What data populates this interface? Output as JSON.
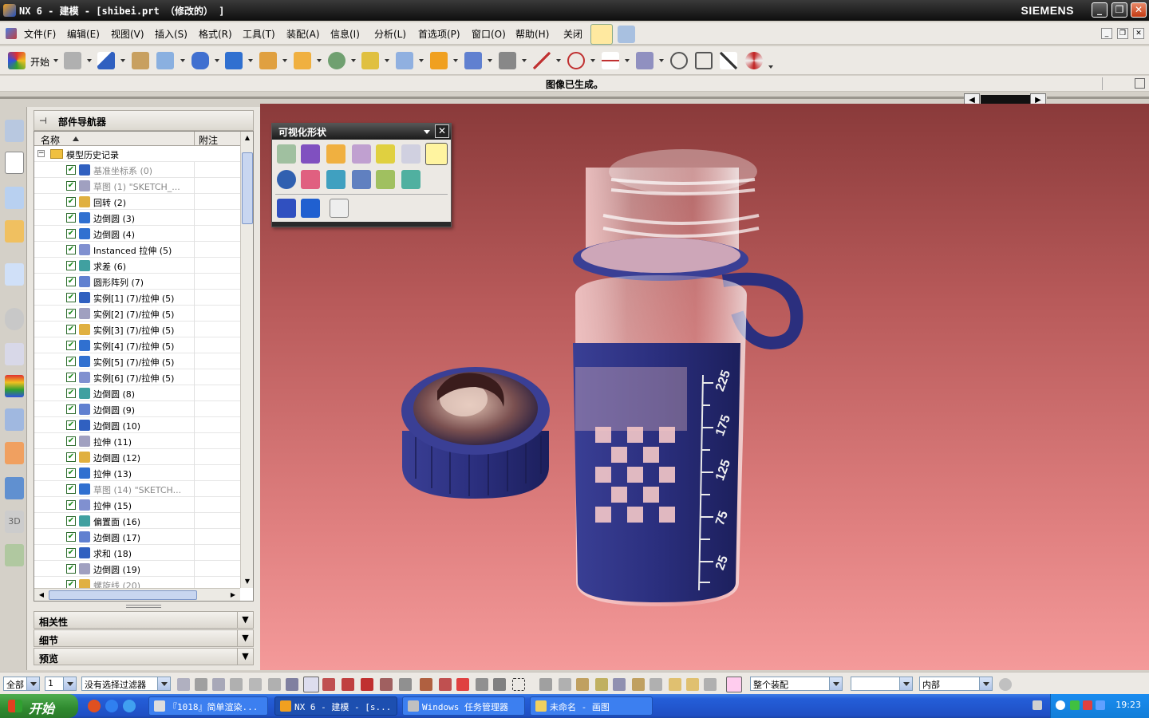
{
  "window": {
    "title": "NX 6 - 建模 - [shibei.prt （修改的） ]",
    "brand": "SIEMENS"
  },
  "menubar": {
    "items": [
      "文件(F)",
      "编辑(E)",
      "视图(V)",
      "插入(S)",
      "格式(R)",
      "工具(T)",
      "装配(A)",
      "信息(I)",
      "分析(L)",
      "首选项(P)",
      "窗口(O)",
      "帮助(H)"
    ],
    "close_label": "关闭"
  },
  "toolbar": {
    "start_label": "开始",
    "icons": [
      "start-icon",
      "sketch-icon",
      "datum-csys-icon",
      "extrude-icon",
      "revolve-icon",
      "cylinder-icon",
      "block-icon",
      "unite-icon",
      "shell-icon",
      "hole-icon",
      "offset-face-icon",
      "surface-icon",
      "blend-icon",
      "mirror-icon",
      "thicken-icon",
      "line-icon",
      "arc-icon",
      "trim-icon",
      "curve-icon",
      "point-icon",
      "scale-icon",
      "move-icon",
      "color-wheel-icon"
    ]
  },
  "statusline": {
    "message": "图像已生成。"
  },
  "navigator": {
    "title": "部件导航器",
    "columns": {
      "name": "名称",
      "note": "附注"
    },
    "root": "模型历史记录",
    "items": [
      {
        "label": "基准坐标系 (0)",
        "grey": true
      },
      {
        "label": "草图 (1) \"SKETCH_...",
        "grey": true
      },
      {
        "label": "回转 (2)",
        "grey": false
      },
      {
        "label": "边倒圆 (3)",
        "grey": false
      },
      {
        "label": "边倒圆 (4)",
        "grey": false
      },
      {
        "label": "Instanced 拉伸 (5)",
        "grey": false
      },
      {
        "label": "求差 (6)",
        "grey": false
      },
      {
        "label": "圆形阵列 (7)",
        "grey": false
      },
      {
        "label": "实例[1] (7)/拉伸 (5)",
        "grey": false
      },
      {
        "label": "实例[2] (7)/拉伸 (5)",
        "grey": false
      },
      {
        "label": "实例[3] (7)/拉伸 (5)",
        "grey": false
      },
      {
        "label": "实例[4] (7)/拉伸 (5)",
        "grey": false
      },
      {
        "label": "实例[5] (7)/拉伸 (5)",
        "grey": false
      },
      {
        "label": "实例[6] (7)/拉伸 (5)",
        "grey": false
      },
      {
        "label": "边倒圆 (8)",
        "grey": false
      },
      {
        "label": "边倒圆 (9)",
        "grey": false
      },
      {
        "label": "边倒圆 (10)",
        "grey": false
      },
      {
        "label": "拉伸 (11)",
        "grey": false
      },
      {
        "label": "边倒圆 (12)",
        "grey": false
      },
      {
        "label": "拉伸 (13)",
        "grey": false
      },
      {
        "label": "草图 (14) \"SKETCH...",
        "grey": true
      },
      {
        "label": "拉伸 (15)",
        "grey": false
      },
      {
        "label": "偏置面 (16)",
        "grey": false
      },
      {
        "label": "边倒圆 (17)",
        "grey": false
      },
      {
        "label": "求和 (18)",
        "grey": false
      },
      {
        "label": "边倒圆 (19)",
        "grey": false
      },
      {
        "label": "螺旋线 (20)",
        "grey": true
      }
    ],
    "sections": [
      "相关性",
      "细节",
      "预览"
    ]
  },
  "palette": {
    "title": "可视化形状"
  },
  "viewport": {
    "scale_marks": [
      "225",
      "175",
      "125",
      "75",
      "25"
    ],
    "accent": "#2b2f7e",
    "background_top": "#8a3a3a",
    "background_bottom": "#f49a9a"
  },
  "selbar": {
    "filter_all": "全部",
    "layer": "1",
    "selection_filter": "没有选择过滤器",
    "scope": "整个装配",
    "blank": "",
    "inside": "内部"
  },
  "taskbar": {
    "start": "开始",
    "tasks": [
      "『1018』简单渲染...",
      "NX 6 - 建模 - [s...",
      "Windows 任务管理器",
      "未命名 - 画图"
    ],
    "clock": "19:23"
  }
}
